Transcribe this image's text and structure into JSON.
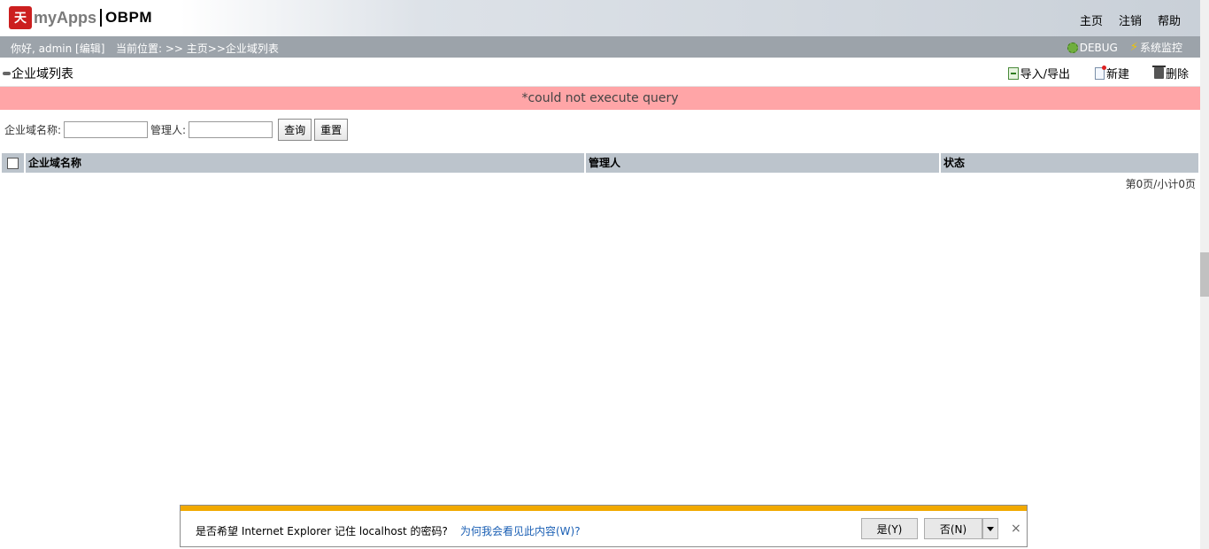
{
  "header": {
    "logo_text": "myApps",
    "logo_product": "OBPM",
    "nav": [
      "主页",
      "注销",
      "帮助"
    ]
  },
  "subbar": {
    "greeting": "你好, admin [编辑]",
    "breadcrumb": "当前位置: >> 主页>>企业域列表",
    "debug_label": "DEBUG",
    "monitor_label": "系统监控"
  },
  "titlebar": {
    "title": "企业域列表",
    "import_export": "导入/导出",
    "new": "新建",
    "delete": "删除"
  },
  "error": {
    "message": "*could not execute query"
  },
  "search": {
    "domain_label": "企业域名称:",
    "domain_value": "",
    "manager_label": "管理人:",
    "manager_value": "",
    "query_button": "查询",
    "reset_button": "重置"
  },
  "table": {
    "columns": [
      "企业域名称",
      "管理人",
      "状态"
    ],
    "rows": []
  },
  "pager": {
    "text": "第0页/小计0页"
  },
  "ie_bar": {
    "message": "是否希望 Internet Explorer 记住 localhost 的密码?",
    "why_link": "为何我会看见此内容(W)?",
    "yes": "是(Y)",
    "no": "否(N)",
    "close": "×",
    "accent_color": "#f1a900"
  },
  "colors": {
    "error_bg": "#ffa5a7",
    "subbar_bg": "#9ca3aa",
    "table_header_bg": "#bcc4cc"
  }
}
